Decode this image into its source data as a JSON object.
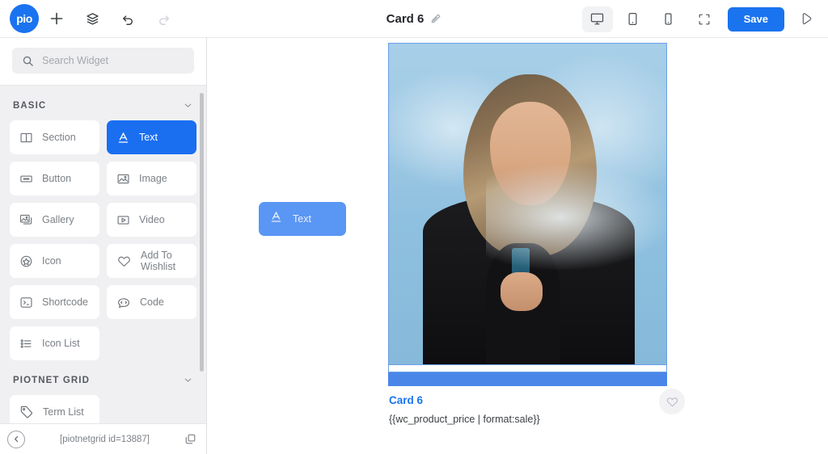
{
  "topbar": {
    "logo_text": "pio",
    "add_icon": "plus-icon",
    "layers_icon": "layers-icon",
    "undo_icon": "undo-icon",
    "redo_icon": "redo-icon",
    "doc_title": "Card 6",
    "edit_icon": "pencil-icon",
    "devices": [
      {
        "name": "desktop-view-button",
        "icon": "desktop-icon",
        "active": true
      },
      {
        "name": "tablet-view-button",
        "icon": "tablet-icon",
        "active": false
      },
      {
        "name": "mobile-view-button",
        "icon": "mobile-icon",
        "active": false
      },
      {
        "name": "fullscreen-button",
        "icon": "fullscreen-icon",
        "active": false
      }
    ],
    "save_label": "Save",
    "preview_icon": "play-icon",
    "accent_color": "#1a73ef"
  },
  "sidebar": {
    "search": {
      "placeholder": "Search Widget",
      "value": "",
      "icon": "search-icon"
    },
    "sections": [
      {
        "label": "BASIC",
        "collapsed": false,
        "widgets": [
          {
            "label": "Section",
            "icon": "section-icon",
            "selected": false
          },
          {
            "label": "Text",
            "icon": "text-icon",
            "selected": true
          },
          {
            "label": "Button",
            "icon": "button-icon",
            "selected": false
          },
          {
            "label": "Image",
            "icon": "image-icon",
            "selected": false
          },
          {
            "label": "Gallery",
            "icon": "gallery-icon",
            "selected": false
          },
          {
            "label": "Video",
            "icon": "video-icon",
            "selected": false
          },
          {
            "label": "Icon",
            "icon": "star-icon",
            "selected": false
          },
          {
            "label": "Add To Wishlist",
            "icon": "heart-icon",
            "selected": false
          },
          {
            "label": "Shortcode",
            "icon": "terminal-icon",
            "selected": false
          },
          {
            "label": "Code",
            "icon": "code-icon",
            "selected": false
          },
          {
            "label": "Icon List",
            "icon": "list-icon",
            "selected": false
          }
        ]
      },
      {
        "label": "PIOTNET GRID",
        "collapsed": false,
        "widgets": [
          {
            "label": "Term List",
            "icon": "tag-icon",
            "selected": false
          }
        ]
      }
    ],
    "footer": {
      "back_icon": "chevron-left-icon",
      "shortcode": "[piotnetgrid id=13887]",
      "copy_icon": "copy-icon"
    }
  },
  "canvas": {
    "drag_ghost": {
      "label": "Text",
      "icon": "text-icon"
    },
    "card": {
      "image_alt": "woman-holding-smoking-cup",
      "title": "Card 6",
      "price": "{{wc_product_price | format:sale}}",
      "wishlist_icon": "heart-icon",
      "drop_indicator_color": "#4a86e8",
      "selection_border_color": "#6a9fe8"
    }
  }
}
